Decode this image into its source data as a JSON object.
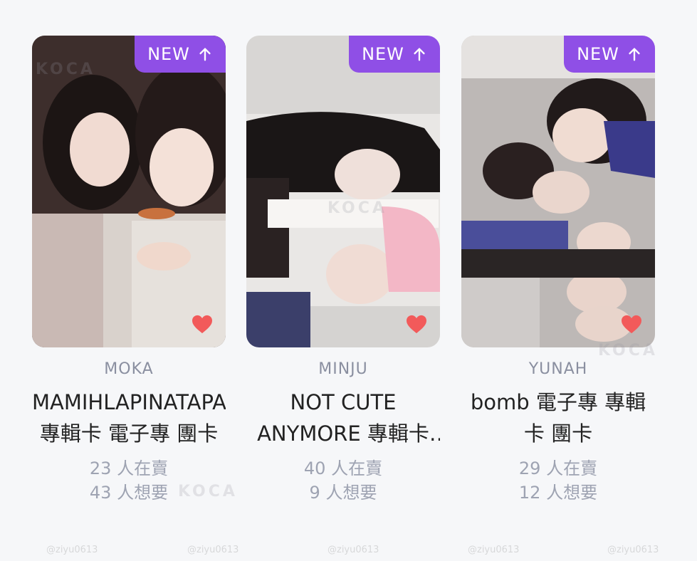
{
  "badge": {
    "label": "NEW",
    "icon": "arrow-up-icon",
    "color": "#8f4fe6"
  },
  "heart": {
    "icon": "heart-icon",
    "color": "#f25a5a"
  },
  "watermark": {
    "handle": "@ziyu0613",
    "logo": "KOCA"
  },
  "cards": [
    {
      "member": "MOKA",
      "title": "MAMIHLAPINATAPAI 專輯卡 電子專 團卡",
      "sellers": "23 人在賣",
      "wanters": "43 人想要"
    },
    {
      "member": "MINJU",
      "title": "NOT CUTE ANYMORE 專輯卡 電子專 團卡",
      "sellers": "40 人在賣",
      "wanters": "9 人想要"
    },
    {
      "member": "YUNAH",
      "title": "bomb 電子專 專輯卡 團卡",
      "sellers": "29 人在賣",
      "wanters": "12 人想要"
    }
  ]
}
